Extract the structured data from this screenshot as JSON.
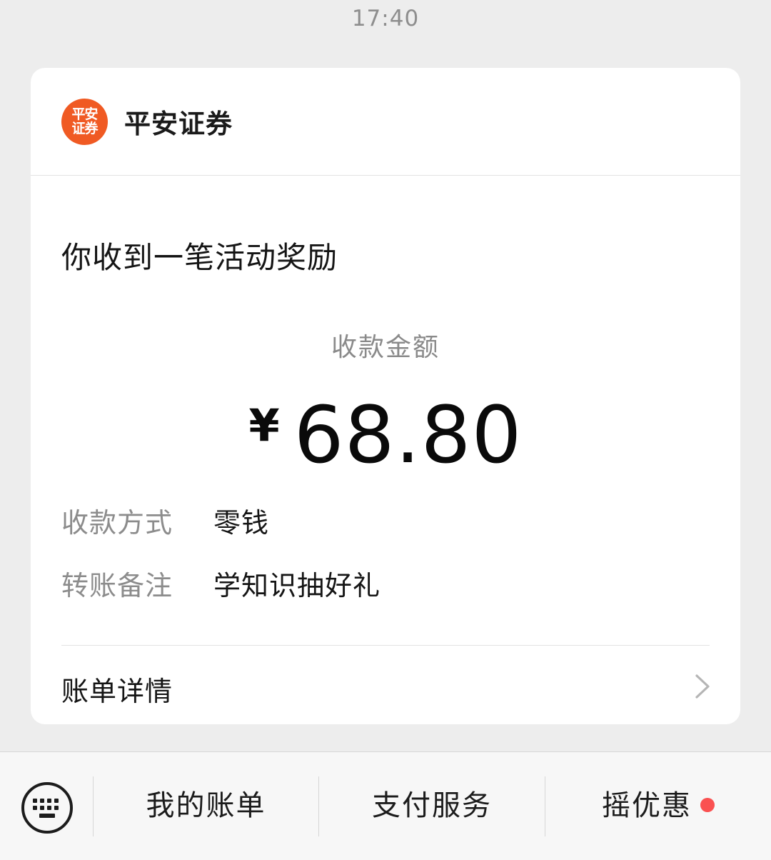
{
  "timestamp": "17:40",
  "card": {
    "logo_text_line1": "平安",
    "logo_text_line2": "证券",
    "brand_name": "平安证券",
    "headline": "你收到一笔活动奖励",
    "amount_label": "收款金额",
    "currency_symbol": "¥",
    "amount_value": "68.80",
    "rows": [
      {
        "label": "收款方式",
        "value": "零钱"
      },
      {
        "label": "转账备注",
        "value": "学知识抽好礼"
      }
    ],
    "detail_label": "账单详情"
  },
  "bottom_bar": {
    "items": [
      {
        "label": "我的账单"
      },
      {
        "label": "支付服务"
      },
      {
        "label": "摇优惠"
      }
    ]
  },
  "colors": {
    "brand_logo": "#f05a23",
    "notification_dot": "#fa5151",
    "background": "#ededed"
  },
  "icons": [
    "keyboard-icon",
    "chevron-right-icon"
  ]
}
